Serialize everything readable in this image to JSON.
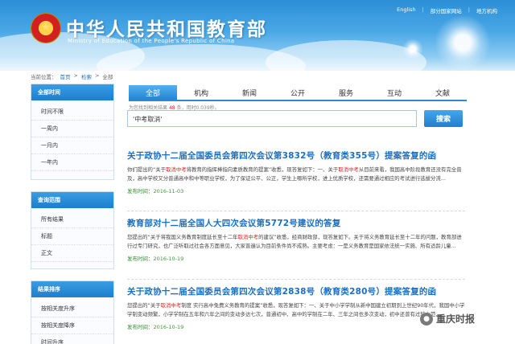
{
  "header": {
    "title": "中华人民共和国教育部",
    "subtitle": "Ministry of Education of the People's Republic of China",
    "links": [
      "English",
      "部分国家网站",
      "地方机构"
    ]
  },
  "breadcrumb": [
    "当前位置：",
    "首页",
    ">",
    "检索",
    ">",
    "全部"
  ],
  "sidebar": {
    "time": {
      "heading": "全部时间",
      "items": [
        "时间不限",
        "一周内",
        "一月内",
        "一年内"
      ]
    },
    "scope": {
      "heading": "查询范围",
      "items": [
        "所有结果",
        "标题",
        "正文"
      ]
    },
    "sort": {
      "heading": "结果排序",
      "items": [
        "按相关度升序",
        "按相关度降序",
        "时间升序"
      ]
    }
  },
  "tabs": [
    "全部",
    "机构",
    "新闻",
    "公开",
    "服务",
    "互动",
    "文献"
  ],
  "result_count": {
    "prefix": "为您找到相关结果",
    "count": "48",
    "mid": "条，用时0.039秒。"
  },
  "search": {
    "value": "'中考取消'",
    "button": "搜索"
  },
  "results": [
    {
      "title": "关于政协十二届全国委员会第四次会议第3832号（教育类355号）提案答复的函",
      "snippet": [
        {
          "t": "你们提出的“关于"
        },
        {
          "t": "取消中考",
          "hl": true
        },
        {
          "t": "将教育的指挥棒指向素质教育的提案”收悉，现答复如下：一、关于"
        },
        {
          "t": "取消中考",
          "hl": true
        },
        {
          "t": "从目前来看，我国高中阶段教育还没有完全普及，高中学校又分普通高中和中等职业学校，为了保证公平、公正，学生上哪所学校，进上优质学校，还需要通过相应的考试进行选拔分流..."
        }
      ],
      "date_label": "发布时间：",
      "date": "2016-11-03"
    },
    {
      "title": "教育部对十二届全国人大四次会议第5772号建议的答复",
      "snippet": [
        {
          "t": "您提出的“关于将我国义务教育制度延长至十二年"
        },
        {
          "t": "取消中考",
          "hl": true
        },
        {
          "t": "的建议”收悉，经商财政部，现答复如下。关于将义务教育延长至十二年的问题，教育部进行过专门研究，也广泛听取过社会各方面意见，大家普遍认为目前条件尚不成熟。主要考虑：一是义务教育是国家依法统一实施、所有适龄儿童..."
        }
      ],
      "date_label": "发布时间：",
      "date": "2016-10-19"
    },
    {
      "title": "关于政协十二届全国委员会第四次会议第2838号（教育类280号）提案答复的函",
      "snippet": [
        {
          "t": "您提出的“关于"
        },
        {
          "t": "取消中考",
          "hl": true
        },
        {
          "t": "制度 实行高中免费义务教育的提案”收悉，现答复如下：一、关于中小学学制从新中国建立初期到上世纪90年代，我国中小学学制变动频繁，小学学制在五年和六年之间的变动多达七次，普通初中、高中的学制在二年、三年之间也多次变动，初中还曾有过较大范..."
        }
      ],
      "date_label": "发布时间：",
      "date": "2016-10-19"
    }
  ],
  "watermark": "重庆时报"
}
